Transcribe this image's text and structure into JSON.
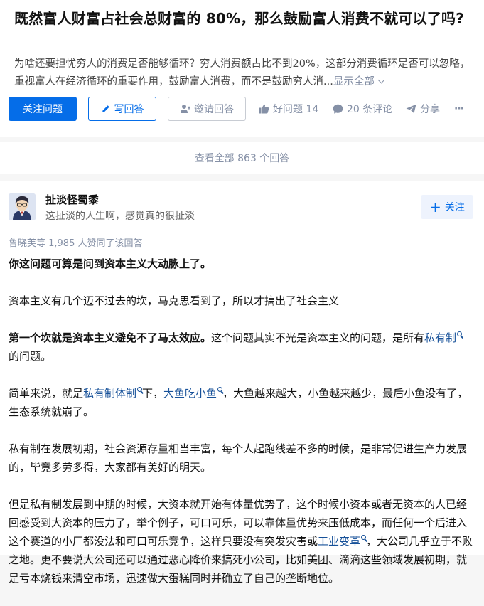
{
  "question": {
    "title": "既然富人财富占社会总财富的 80%，那么鼓励富人消费不就可以了吗?",
    "detail": "为啥还要担忧穷人的消费是否能够循环？穷人消费额占比不到20%，这部分消费循环是否可以忽略，重视富人在经济循环的重要作用，鼓励富人消费，而不是鼓励穷人消...",
    "show_all_label": "显示全部",
    "actions": {
      "follow_label": "关注问题",
      "write_label": "写回答",
      "invite_label": "邀请回答",
      "good_question_label": "好问题 14",
      "comments_label": "20 条评论",
      "share_label": "分享",
      "more_label": "···"
    }
  },
  "view_all_answers_label": "查看全部 863 个回答",
  "answer": {
    "author": {
      "name": "扯淡怪蜀黍",
      "bio": "这扯淡的人生啊，感觉真的很扯淡",
      "follow_label": "关注",
      "follow_plus": "+"
    },
    "vote_summary": "鲁晓芙等 1,985 人赞同了该回答",
    "paragraphs": {
      "p1": "你这问题可算是问到资本主义大动脉上了。",
      "p2": "资本主义有几个迈不过去的坎，马克思看到了，所以才搞出了社会主义",
      "p3_bold": "第一个坎就是资本主义避免不了马太效应。",
      "p3_text": "这个问题其实不光是资本主义的问题，是所有",
      "p3_link": "私有制",
      "p3_tail": "的问题。",
      "p4_a": "简单来说，就是",
      "p4_link1": "私有制体制",
      "p4_b": "下，",
      "p4_link2": "大鱼吃小鱼",
      "p4_c": "，大鱼越来越大，小鱼越来越少，最后小鱼没有了，生态系统就崩了。",
      "p5": "私有制在发展初期，社会资源存量相当丰富，每个人起跑线差不多的时候，是非常促进生产力发展的，毕竟多劳多得，大家都有美好的明天。",
      "p6_a": "但是私有制发展到中期的时候，大资本就开始有体量优势了，这个时候小资本或者无资本的人已经回感受到大资本的压力了，举个例子，可口可乐，可以靠体量优势来压低成本，而任何一个后进入这个赛道的小厂都没法和可口可乐竞争，这样只要没有突发灾害或",
      "p6_link": "工业变革",
      "p6_b": "，大公司几乎立于不败之地。更不要说大公司还可以通过恶心降价来搞死小公司，比如美团、滴滴这些领域发展初期，就是亏本烧钱来清空市场，迅速做大蛋糕同时并确立了自己的垄断地位。"
    }
  },
  "colors": {
    "primary": "#056de8",
    "link": "#175199",
    "muted": "#8590a6",
    "background": "#f6f6f6"
  }
}
